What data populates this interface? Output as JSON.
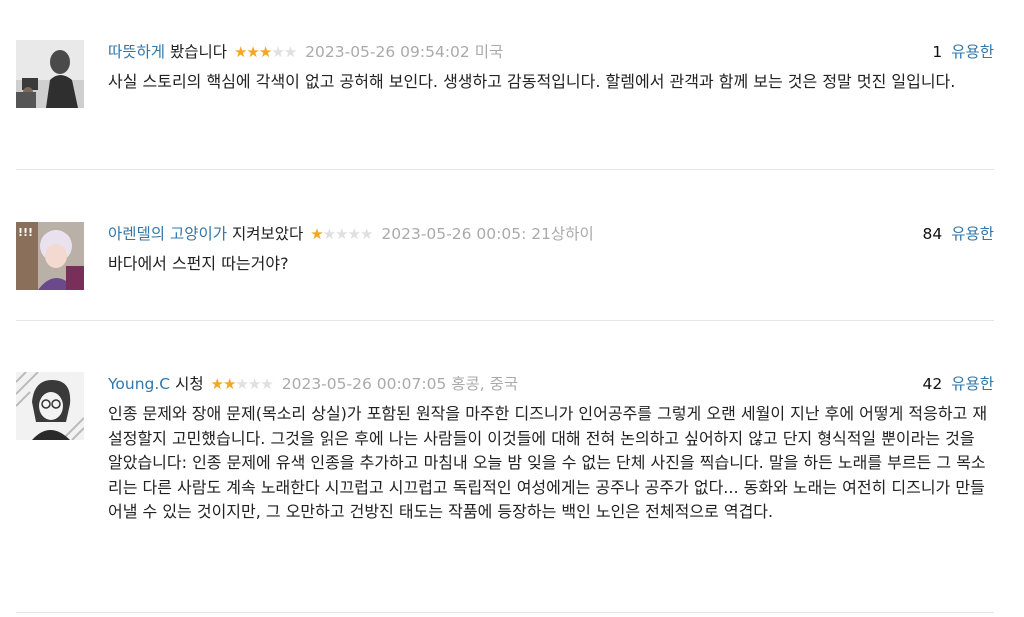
{
  "reviews": [
    {
      "name": "따뜻하게",
      "action": "봤습니다",
      "stars_on": "★★★",
      "stars_off": "★★",
      "meta": "2023-05-26 09:54:02 미국",
      "useful_count": "1",
      "useful_label": "유용한",
      "text": "사실 스토리의 핵심에 각색이 없고 공허해 보인다. 생생하고 감동적입니다. 할렘에서 관객과 함께 보는 것은 정말 멋진 일입니다."
    },
    {
      "name": "아렌델의 고양이가",
      "action": "지켜보았다",
      "stars_on": "★",
      "stars_off": "★★★★",
      "meta": "2023-05-26 00:05: 21상하이",
      "useful_count": "84",
      "useful_label": "유용한",
      "text": "바다에서 스펀지 따는거야?"
    },
    {
      "name": "Young.C",
      "action": "시청",
      "stars_on": "★★",
      "stars_off": "★★★",
      "meta": "2023-05-26 00:07:05 홍콩, 중국",
      "useful_count": "42",
      "useful_label": "유용한",
      "text": "인종 문제와 장애 문제(목소리 상실)가 포함된 원작을 마주한 디즈니가 인어공주를 그렇게 오랜 세월이 지난 후에 어떻게 적응하고 재설정할지 고민했습니다. 그것을 읽은 후에 나는 사람들이 이것들에 대해 전혀 논의하고 싶어하지 않고 단지 형식적일 뿐이라는 것을 알았습니다: 인종 문제에 유색 인종을 추가하고 마침내 오늘 밤 잊을 수 없는 단체 사진을 찍습니다. 말을 하든 노래를 부르든 그 목소리는 다른 사람도 계속 노래한다 시끄럽고 시끄럽고 독립적인 여성에게는 공주나 공주가 없다... 동화와 노래는 여전히 디즈니가 만들어낼 수 있는 것이지만, 그 오만하고 건방진 태도는 작품에 등장하는 백인 노인은 전체적으로 역겹다."
    }
  ]
}
